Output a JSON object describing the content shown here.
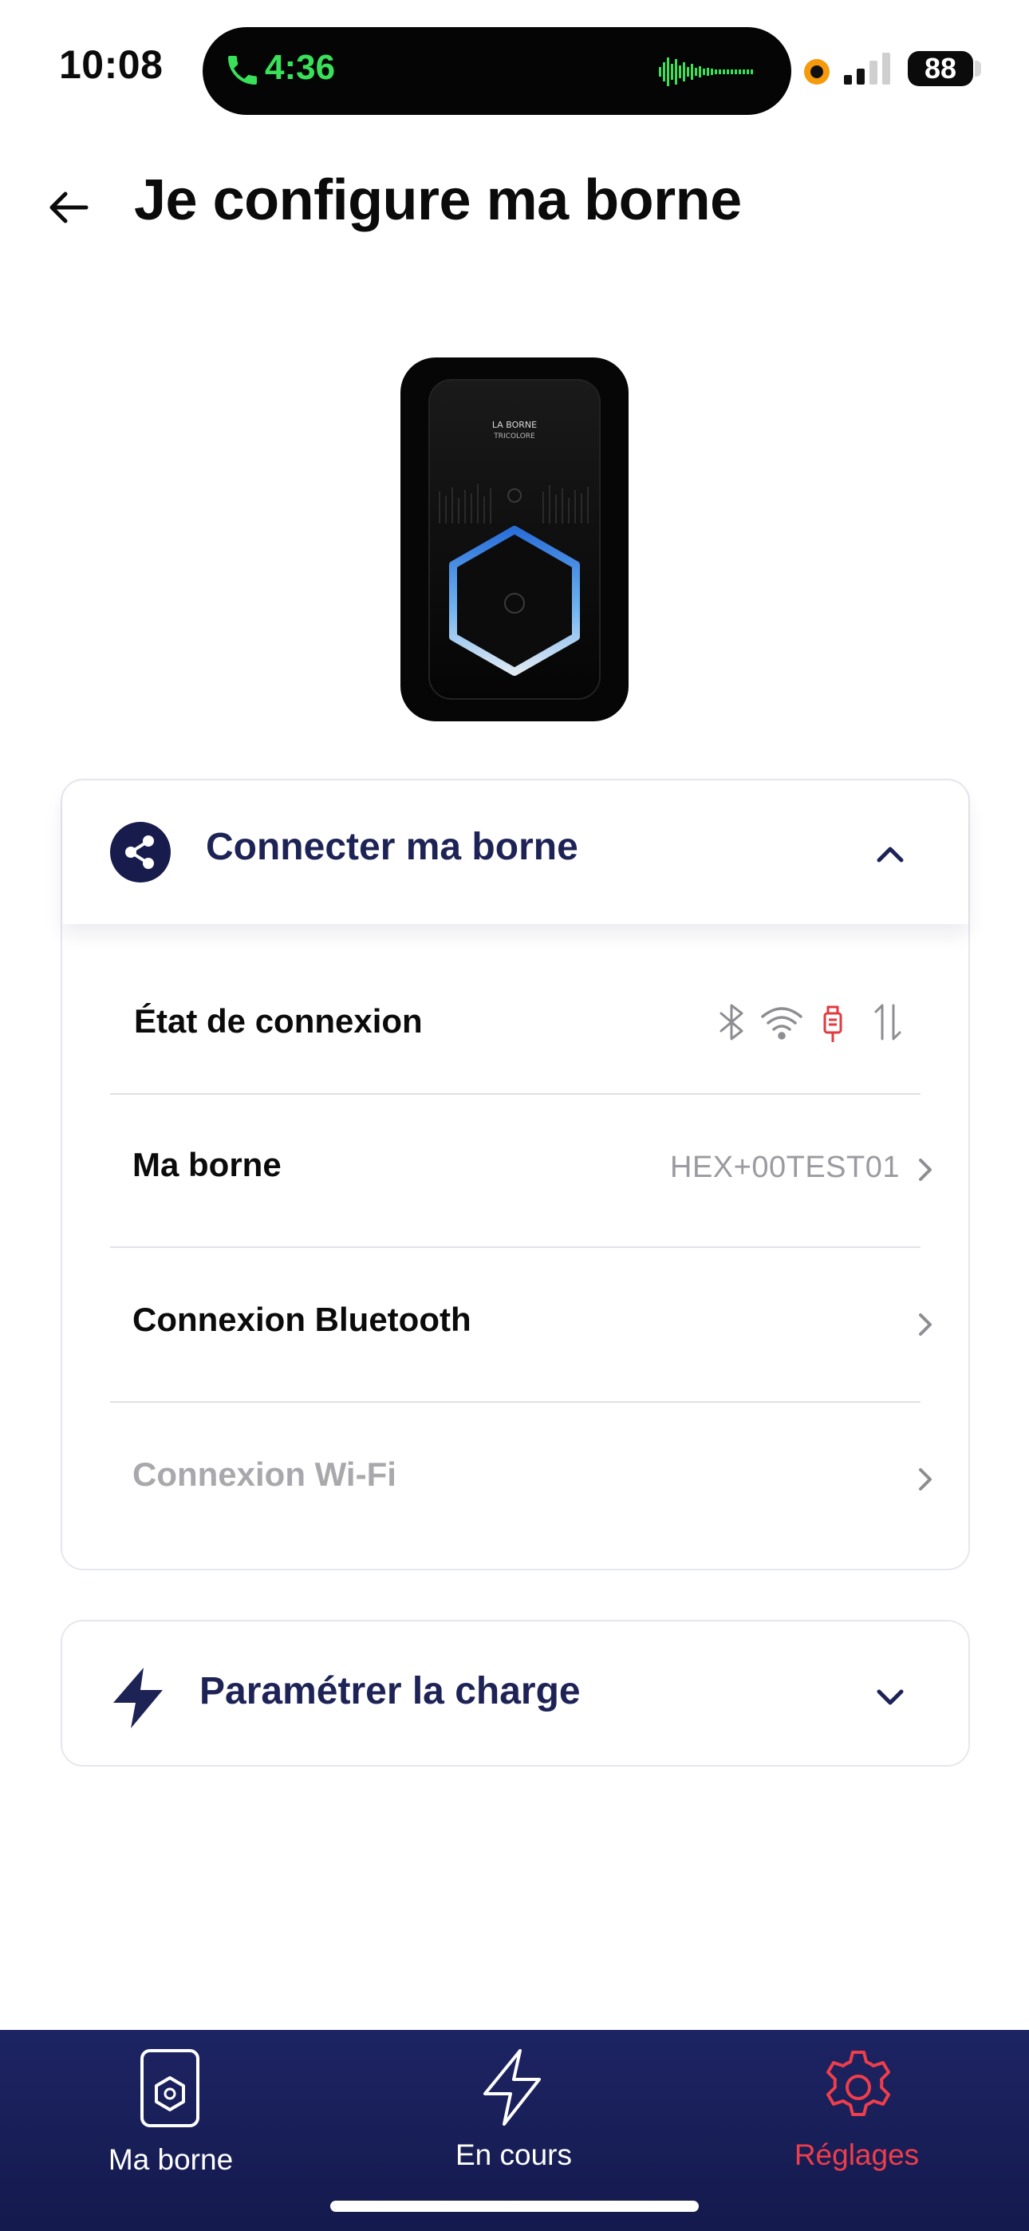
{
  "status_bar": {
    "time": "10:08",
    "call_duration": "4:36",
    "battery": "88"
  },
  "header": {
    "title": "Je configure ma borne"
  },
  "device_image": {
    "brand_line1": "LA BORNE",
    "brand_line2": "TRICOLORE"
  },
  "connect_section": {
    "title": "Connecter ma borne",
    "expanded": true,
    "rows": {
      "status_label": "État de connexion",
      "status_icons": [
        "bluetooth-icon",
        "wifi-icon",
        "ethernet-icon",
        "data-transfer-icon"
      ],
      "borne_label": "Ma borne",
      "borne_value": "HEX+00TEST01",
      "bluetooth_label": "Connexion Bluetooth",
      "wifi_label": "Connexion Wi-Fi"
    }
  },
  "charge_section": {
    "title": "Paramétrer la charge",
    "expanded": false
  },
  "tabbar": {
    "tabs": [
      {
        "label": "Ma borne",
        "icon": "borne-icon"
      },
      {
        "label": "En cours",
        "icon": "bolt-icon"
      },
      {
        "label": "Réglages",
        "icon": "gear-icon",
        "active": true
      }
    ]
  },
  "colors": {
    "brand_navy": "#1e2356",
    "tab_bar": "#1d2463",
    "active_red": "#ef3e4b",
    "call_green": "#39e05a"
  }
}
